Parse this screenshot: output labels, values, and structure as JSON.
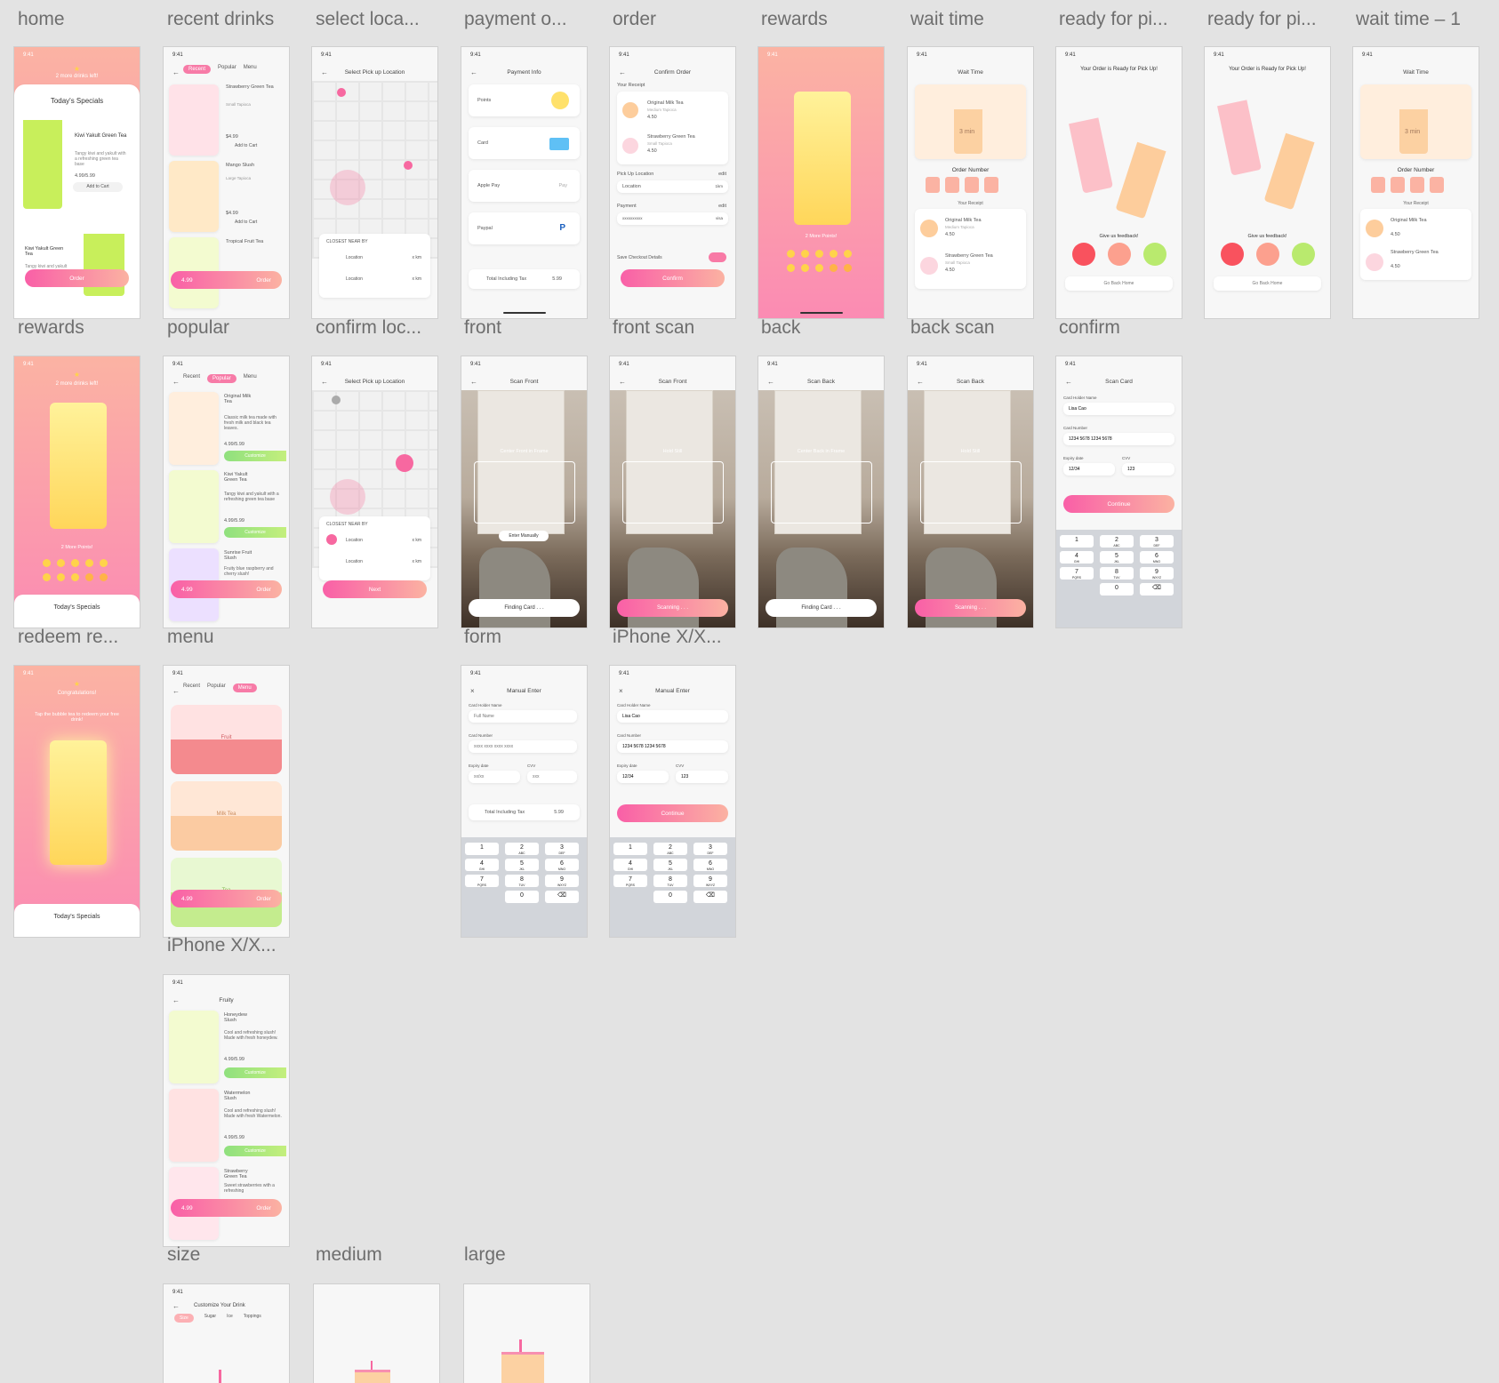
{
  "titles": {
    "home": "home",
    "recent_drinks": "recent drinks",
    "select_location": "select loca...",
    "payment": "payment o...",
    "order": "order",
    "rewards": "rewards",
    "wait_time": "wait time",
    "ready_1": "ready for pi...",
    "ready_2": "ready for pi...",
    "wait_time_1": "wait time – 1",
    "rewards_2": "rewards",
    "popular": "popular",
    "confirm_location": "confirm loc...",
    "front": "front",
    "front_scan": "front scan",
    "back": "back",
    "back_scan": "back scan",
    "confirm": "confirm",
    "redeem": "redeem re...",
    "menu": "menu",
    "form": "form",
    "iphone_form": "iPhone X/X...",
    "iphone_menu": "iPhone X/X...",
    "size": "size",
    "medium": "medium",
    "large": "large"
  },
  "status": {
    "time": "9:41",
    "icons": "▮▮ ◠ ▬"
  },
  "home": {
    "banner": "2 more drinks left!",
    "section": "Today's Specials",
    "item1_name": "Kiwi Yakult Green Tea",
    "item1_desc": "Tangy kiwi and yakult with a refreshing green tea base",
    "item1_price": "4.99/5.99",
    "add_cart": "Add to Cart",
    "item2_name": "Kiwi Yakult Green Tea",
    "item2_desc": "Tangy kiwi and yakult",
    "order_btn": "Order"
  },
  "recent": {
    "tabs": [
      "Recent",
      "Popular",
      "Menu"
    ],
    "items": [
      {
        "name": "Strawberry Green Tea",
        "opts": "Small  Tapioca",
        "price": "$4.99",
        "cta": "Add to Cart"
      },
      {
        "name": "Mango Slush",
        "opts": "Large  Tapioca",
        "price": "$4.99",
        "cta": "Add to Cart"
      },
      {
        "name": "Tropical Fruit Tea",
        "opts": "Small  Tapioca",
        "price": "",
        "cta": "Add to Cart"
      }
    ],
    "price_btn": "4.99",
    "order_btn": "Order"
  },
  "select_location": {
    "header": "Select Pick up Location",
    "closest": "CLOSEST NEAR BY",
    "loc1": "Location",
    "loc2": "Location",
    "dist": "x km"
  },
  "payment": {
    "header": "Payment Info",
    "options": [
      "Points",
      "Card",
      "Apple Pay",
      "Paypal"
    ],
    "total_label": "Total Including Tax",
    "total": "5.99"
  },
  "order": {
    "header": "Confirm Order",
    "receipt": "Your Receipt",
    "item1": "Original Milk Tea",
    "item1_opts": "Medium  Tapioca",
    "item1_price": "4.50",
    "item2": "Strawberry Green Tea",
    "item2_opts": "Small  Tapioca",
    "item2_price": "4.50",
    "pickup": "Pick Up Location",
    "edit": "edit",
    "location": "Location",
    "km": "1km",
    "payment": "Payment",
    "card": "xxxxxxxxxx",
    "visa": "visa",
    "save": "Save Checkout Details",
    "confirm_btn": "Confirm"
  },
  "rewards": {
    "points": "2 More Points!"
  },
  "wait": {
    "header": "Wait Time",
    "minutes": "3 min",
    "order_number": "Order Number",
    "receipt": "Your Receipt",
    "item1": "Original Milk Tea",
    "item1_opts": "Medium  Tapioca",
    "item1_price": "4.50",
    "item2": "Strawberry Green Tea",
    "item2_opts": "Small  Tapioca",
    "item2_price": "4.50"
  },
  "ready": {
    "header": "Your Order is Ready for Pick Up!",
    "feedback": "Give us feedback!",
    "home_btn": "Go Back Home"
  },
  "rewards2": {
    "banner": "2 more drinks left!",
    "points": "2 More Points!",
    "section": "Today's Specials"
  },
  "popular": {
    "tabs": [
      "Recent",
      "Popular",
      "Menu"
    ],
    "items": [
      {
        "name": "Original Milk Tea",
        "desc": "Classic milk tea made with fresh milk and black tea leaves.",
        "price": "4.99/5.99"
      },
      {
        "name": "Kiwi Yakult Green Tea",
        "desc": "Tangy kiwi and yakult with a refreshing green tea base",
        "price": "4.99/5.99"
      },
      {
        "name": "Sunrise Fruit Slush",
        "desc": "Fruity blue raspberry and cherry slush!",
        "price": ""
      }
    ],
    "customize": "Customize",
    "price_btn": "4.99",
    "order_btn": "Order"
  },
  "confirm_location": {
    "header": "Select Pick up Location",
    "closest": "CLOSEST NEAR BY",
    "loc": "Location",
    "dist": "x km",
    "next_btn": "Next"
  },
  "scan": {
    "front_header": "Scan Front",
    "back_header": "Scan Back",
    "center_front": "Center Front in Frame",
    "center_back": "Center Back in Frame",
    "hold": "Hold Still",
    "manual": "Enter Manually",
    "finding": "Finding Card . . .",
    "scanning": "Scanning . . ."
  },
  "scan_card": {
    "header": "Scan Card",
    "holder_label": "Card Holder Name",
    "holder": "Lisa Cao",
    "number_label": "Card Number",
    "number": "1234 5678 1234 5678",
    "expiry_label": "Expiry date",
    "expiry": "12/34",
    "cvv_label": "CVV",
    "cvv": "123",
    "continue_btn": "Continue"
  },
  "keypad": [
    {
      "n": "1",
      "l": ""
    },
    {
      "n": "2",
      "l": "ABC"
    },
    {
      "n": "3",
      "l": "DEF"
    },
    {
      "n": "4",
      "l": "GHI"
    },
    {
      "n": "5",
      "l": "JKL"
    },
    {
      "n": "6",
      "l": "MNO"
    },
    {
      "n": "7",
      "l": "PQRS"
    },
    {
      "n": "8",
      "l": "TUV"
    },
    {
      "n": "9",
      "l": "WXYZ"
    },
    {
      "n": "",
      "l": ""
    },
    {
      "n": "0",
      "l": ""
    },
    {
      "n": "⌫",
      "l": ""
    }
  ],
  "redeem": {
    "banner": "Congratulations!",
    "msg": "Tap the bubble tea to redeem your free drink!",
    "section": "Today's Specials"
  },
  "menu": {
    "tabs": [
      "Recent",
      "Popular",
      "Menu"
    ],
    "cats": [
      "Fruit",
      "Milk Tea",
      "Tea"
    ],
    "price_btn": "4.99",
    "order_btn": "Order"
  },
  "manual": {
    "header": "Manual Enter",
    "holder_label": "Card Holder Name",
    "holder_ph": "Full Name",
    "number_label": "Card Number",
    "number_ph": "xxxx xxxx xxxx xxxx",
    "expiry_label": "Expiry date",
    "expiry_ph": "xx/xx",
    "cvv_label": "CVV",
    "cvv_ph": "xxx",
    "total_label": "Total Including Tax",
    "total": "5.99",
    "holder": "Lisa Cao",
    "number": "1234 5678 1234 5678",
    "expiry": "12/34",
    "cvv": "123",
    "continue_btn": "Continue"
  },
  "fruity": {
    "header": "Fruity",
    "items": [
      {
        "name": "Honeydew Slush",
        "desc": "Cool and refreshing slush! Made with fresh honeydew.",
        "price": "4.99/5.99"
      },
      {
        "name": "Watermelon Slush",
        "desc": "Cool and refreshing slush! Made with fresh Watermelon.",
        "price": "4.99/5.99"
      },
      {
        "name": "Strawberry Green Tea",
        "desc": "Sweet strawberries with a refreshing",
        "price": ""
      }
    ],
    "customize": "Customize",
    "price_btn": "4.99",
    "order_btn": "Order"
  },
  "customize": {
    "header": "Customize Your Drink",
    "tabs": [
      "Size",
      "Sugar",
      "Ice",
      "Toppings"
    ]
  }
}
